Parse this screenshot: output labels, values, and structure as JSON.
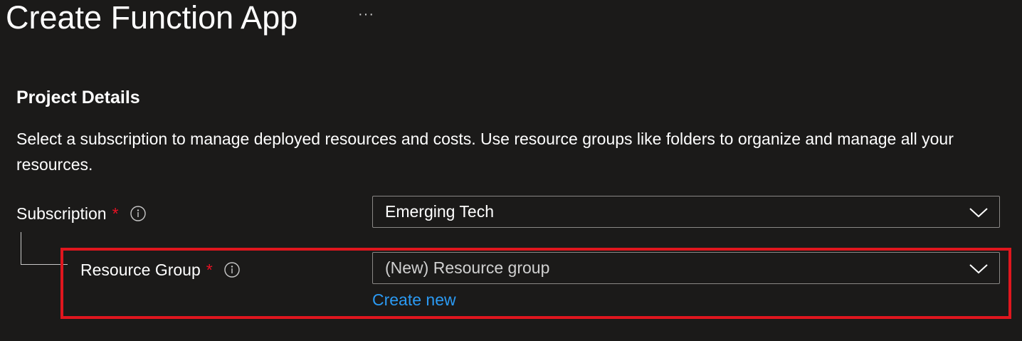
{
  "header": {
    "title": "Create Function App",
    "more_label": "···"
  },
  "project_details": {
    "heading": "Project Details",
    "description": "Select a subscription to manage deployed resources and costs. Use resource groups like folders to organize and manage all your resources."
  },
  "subscription": {
    "label": "Subscription",
    "required_marker": "*",
    "info_icon": "info-icon",
    "value": "Emerging Tech"
  },
  "resource_group": {
    "label": "Resource Group",
    "required_marker": "*",
    "info_icon": "info-icon",
    "value": "(New) Resource group",
    "create_new_label": "Create new"
  },
  "colors": {
    "background": "#1b1a19",
    "required": "#e81123",
    "link": "#2b9af3",
    "highlight": "#e0161e",
    "border": "#8a8886"
  }
}
